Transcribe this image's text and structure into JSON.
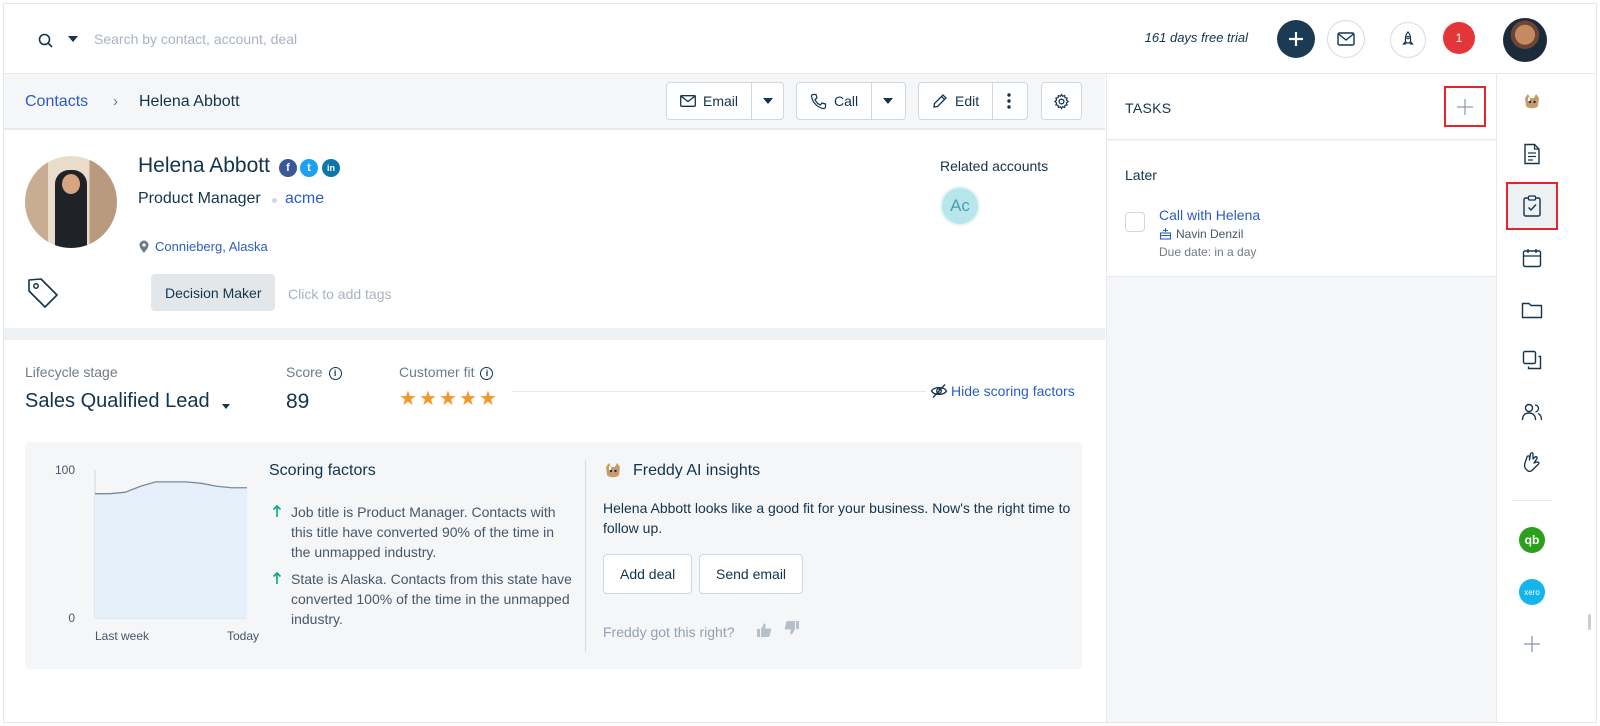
{
  "search": {
    "placeholder": "Search by contact, account, deal",
    "icon": "search-icon"
  },
  "topbar": {
    "trial_text": "161 days free trial",
    "notification_count": "1"
  },
  "breadcrumb": {
    "parent": "Contacts",
    "separator": "›",
    "current": "Helena Abbott"
  },
  "actions": {
    "email_label": "Email",
    "call_label": "Call",
    "edit_label": "Edit"
  },
  "contact": {
    "name": "Helena Abbott",
    "title": "Product Manager",
    "company": "acme",
    "location": "Connieberg, Alaska",
    "social": [
      "f",
      "t",
      "in"
    ],
    "tags": [
      "Decision Maker"
    ],
    "tag_placeholder": "Click to add tags"
  },
  "related": {
    "label": "Related accounts",
    "accounts": [
      "Ac"
    ]
  },
  "scoring": {
    "lifecycle_label": "Lifecycle stage",
    "lifecycle_value": "Sales Qualified Lead",
    "score_label": "Score",
    "score_value": "89",
    "fit_label": "Customer fit",
    "fit_stars": 5,
    "hide_link": "Hide scoring factors"
  },
  "chart_data": {
    "type": "area",
    "x_labels": [
      "Last week",
      "Today"
    ],
    "y_ticks": [
      "100",
      "0"
    ],
    "ylim": [
      0,
      100
    ],
    "values": [
      84,
      84,
      85,
      89,
      92,
      92,
      92,
      91,
      89,
      88,
      88
    ]
  },
  "factors": {
    "title": "Scoring factors",
    "items": [
      "Job title is Product Manager. Contacts with this title have converted 90% of the time in the unmapped industry.",
      "State is Alaska. Contacts from this state have converted 100% of the time in the unmapped industry."
    ]
  },
  "freddy": {
    "title": "Freddy AI insights",
    "text": "Helena Abbott looks like a good fit for your business. Now's the right time to follow up.",
    "add_deal": "Add deal",
    "send_email": "Send email",
    "feedback": "Freddy got this right?"
  },
  "tasks": {
    "title": "TASKS",
    "group": "Later",
    "items": [
      {
        "title": "Call with Helena",
        "owner": "Navin Denzil",
        "due": "Due date: in a day"
      }
    ]
  },
  "rail": {
    "icons": [
      "freddy-icon",
      "document-icon",
      "task-icon",
      "calendar-icon",
      "folder-icon",
      "copy-icon",
      "contacts-icon",
      "handshake-icon",
      "quickbooks-icon",
      "xero-icon",
      "add-integration-icon"
    ],
    "selected": "task-icon",
    "xero_label": "xero",
    "quickbooks_label": "qb"
  },
  "colors": {
    "accent": "#2c5cc5",
    "primary_dark": "#1b3b55",
    "highlight": "#e5252a",
    "star": "#f2982a",
    "positive": "#00a886"
  }
}
